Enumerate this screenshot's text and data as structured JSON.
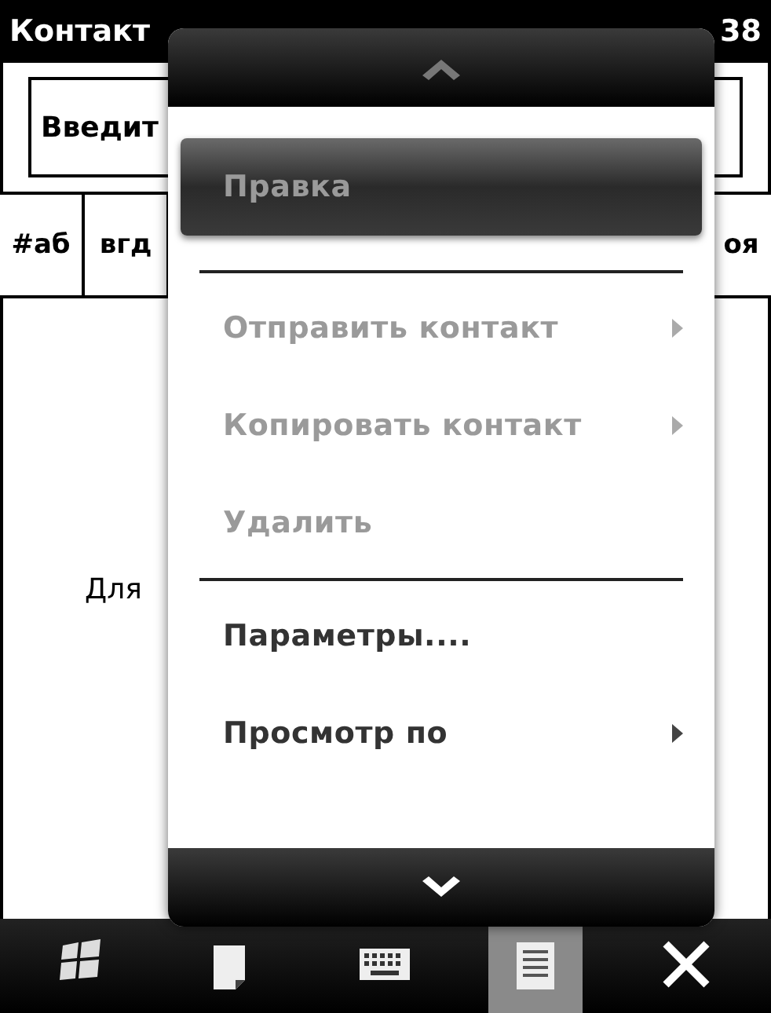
{
  "title_bar": {
    "title": "Контакт",
    "time": "38"
  },
  "search": {
    "placeholder": "Введит"
  },
  "letter_tabs": [
    {
      "label": "#аб"
    },
    {
      "label": "вгд"
    },
    {
      "label": "оя"
    }
  ],
  "body_text": "Для",
  "menu": {
    "items": [
      {
        "kind": "item",
        "label": "Правка",
        "selected": true,
        "disabled": true,
        "submenu": false
      },
      {
        "kind": "separator"
      },
      {
        "kind": "item",
        "label": "Отправить контакт",
        "selected": false,
        "disabled": true,
        "submenu": true
      },
      {
        "kind": "item",
        "label": "Копировать контакт",
        "selected": false,
        "disabled": true,
        "submenu": true
      },
      {
        "kind": "item",
        "label": "Удалить",
        "selected": false,
        "disabled": true,
        "submenu": false
      },
      {
        "kind": "separator"
      },
      {
        "kind": "item",
        "label": "Параметры....",
        "selected": false,
        "disabled": false,
        "submenu": false
      },
      {
        "kind": "item",
        "label": "Просмотр по",
        "selected": false,
        "disabled": false,
        "submenu": true
      }
    ]
  },
  "taskbar": [
    {
      "kind": "start",
      "selected": false
    },
    {
      "kind": "note",
      "selected": false
    },
    {
      "kind": "keyboard",
      "selected": false
    },
    {
      "kind": "menu",
      "selected": true
    },
    {
      "kind": "close",
      "selected": false
    }
  ]
}
